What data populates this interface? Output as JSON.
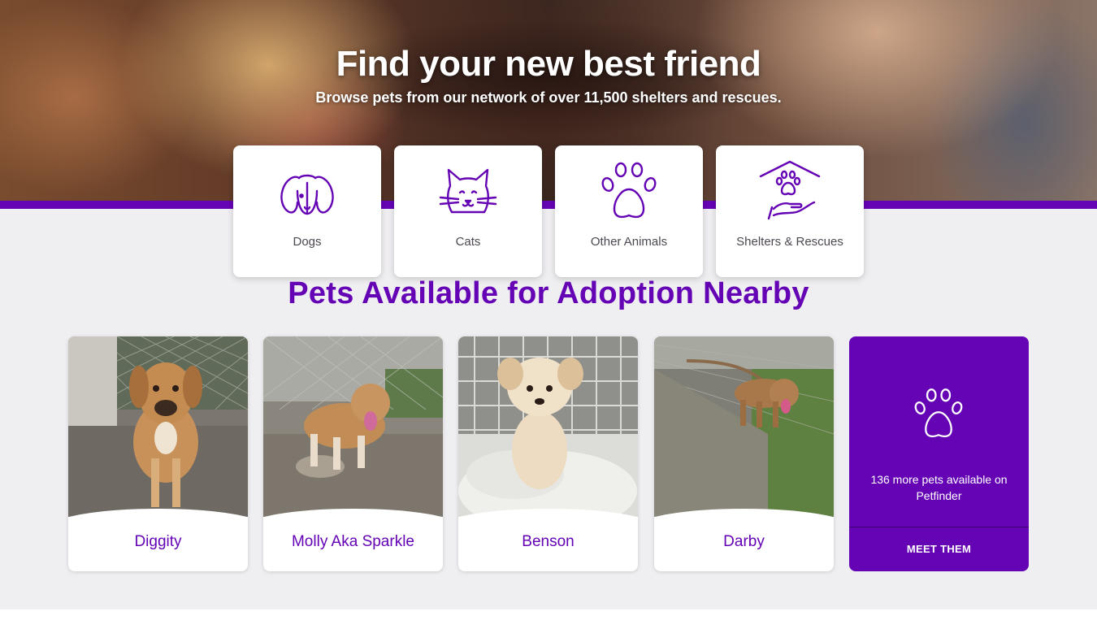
{
  "hero": {
    "title": "Find your new best friend",
    "subtitle": "Browse pets from our network of over 11,500 shelters and rescues."
  },
  "categories": [
    {
      "label": "Dogs",
      "icon": "dog-icon"
    },
    {
      "label": "Cats",
      "icon": "cat-icon"
    },
    {
      "label": "Other Animals",
      "icon": "paw-icon"
    },
    {
      "label": "Shelters & Rescues",
      "icon": "shelter-icon"
    }
  ],
  "section": {
    "title": "Pets Available for Adoption Nearby"
  },
  "pets": [
    {
      "name": "Diggity"
    },
    {
      "name": "Molly Aka Sparkle"
    },
    {
      "name": "Benson"
    },
    {
      "name": "Darby"
    }
  ],
  "more": {
    "text": "136 more pets available on Petfinder",
    "cta": "MEET THEM",
    "icon": "paw-icon"
  },
  "colors": {
    "brand_purple": "#6504b5",
    "background": "#efeef1",
    "card": "#ffffff"
  }
}
